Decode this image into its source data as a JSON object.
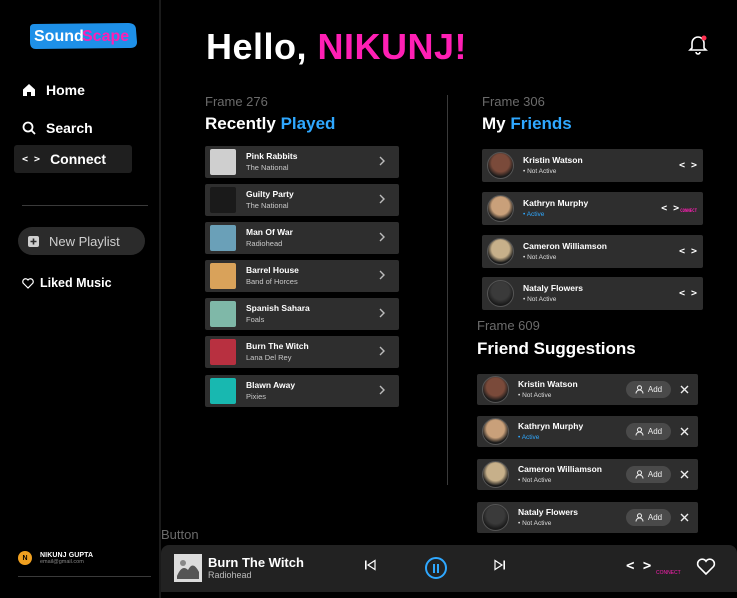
{
  "brand": {
    "sound": "Sound",
    "scape": "Scape",
    "colors": {
      "sound": "#ffffff",
      "scape": "#ff1fb4",
      "bg": "#1e90e8"
    }
  },
  "nav": {
    "home": "Home",
    "search": "Search",
    "connect_glyph": "< >",
    "connect": "Connect",
    "new_playlist": "New Playlist",
    "liked": "Liked Music"
  },
  "user": {
    "initial": "N",
    "name": "NIKUNJ GUPTA",
    "email": "email@gmail.com"
  },
  "greeting": {
    "hello": "Hello, ",
    "name": "NIKUNJ!"
  },
  "recent": {
    "frame": "Frame 276",
    "title_a": "Recently ",
    "title_b": "Played",
    "songs": [
      {
        "title": "Pink Rabbits",
        "artist": "The National",
        "thumb_color": "#cfcfcf"
      },
      {
        "title": "Guilty Party",
        "artist": "The National",
        "thumb_color": "#1a1a1a"
      },
      {
        "title": "Man Of War",
        "artist": "Radiohead",
        "thumb_color": "#6aa0b8"
      },
      {
        "title": "Barrel House",
        "artist": "Band of Horces",
        "thumb_color": "#d9a25a"
      },
      {
        "title": "Spanish Sahara",
        "artist": "Foals",
        "thumb_color": "#7fb8a8"
      },
      {
        "title": "Burn The Witch",
        "artist": "Lana Del Rey",
        "thumb_color": "#b83040"
      },
      {
        "title": "Blawn Away",
        "artist": "Pixies",
        "thumb_color": "#18b8b0"
      }
    ]
  },
  "friends": {
    "frame": "Frame 306",
    "title_a": "My ",
    "title_b": "Friends",
    "code": "< >",
    "connect": "CONNECT",
    "items": [
      {
        "name": "Kristin Watson",
        "status": "• Not Active",
        "active": false
      },
      {
        "name": "Kathryn Murphy",
        "status": "• Active",
        "active": true
      },
      {
        "name": "Cameron Williamson",
        "status": "• Not Active",
        "active": false
      },
      {
        "name": "Nataly Flowers",
        "status": "• Not Active",
        "active": false
      }
    ]
  },
  "suggestions": {
    "frame": "Frame 609",
    "title": "Friend Suggestions",
    "add_label": "Add",
    "items": [
      {
        "name": "Kristin Watson",
        "status": "• Not Active",
        "active": false
      },
      {
        "name": "Kathryn Murphy",
        "status": "• Active",
        "active": true
      },
      {
        "name": "Cameron Williamson",
        "status": "• Not Active",
        "active": false
      },
      {
        "name": "Nataly Flowers",
        "status": "• Not Active",
        "active": false
      }
    ]
  },
  "button_label": "Button",
  "player": {
    "title": "Burn The Witch",
    "artist": "Radiohead",
    "code": "< >",
    "connect": "CONNECT",
    "accent": "#2fa8ff"
  }
}
